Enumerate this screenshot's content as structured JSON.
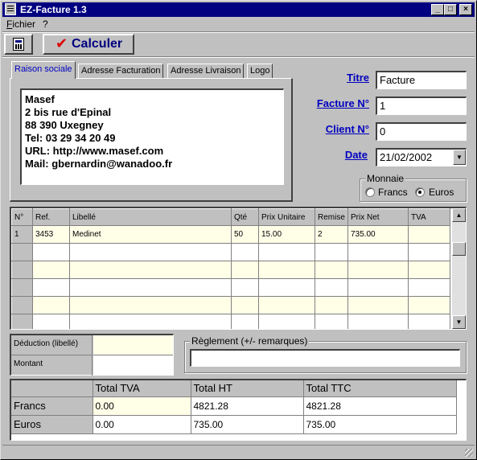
{
  "app": {
    "title": "EZ-Facture 1.3"
  },
  "menu": {
    "items": [
      "Fichier",
      "?"
    ]
  },
  "toolbar": {
    "calculate_label": "Calculer"
  },
  "tabs": [
    "Raison sociale",
    "Adresse Facturation",
    "Adresse Livraison",
    "Logo"
  ],
  "address": {
    "lines": [
      "Masef",
      "2 bis rue d'Epinal",
      "88 390 Uxegney",
      "Tel: 03 29 34 20 49",
      "URL: http://www.masef.com",
      "Mail: gbernardin@wanadoo.fr"
    ]
  },
  "fields": {
    "titre_label": "Titre",
    "titre_value": "Facture",
    "facture_label": "Facture N°",
    "facture_value": "1",
    "client_label": "Client N°",
    "client_value": "0",
    "date_label": "Date",
    "date_value": "21/02/2002"
  },
  "monnaie": {
    "title": "Monnaie",
    "francs": "Francs",
    "euros": "Euros",
    "selected": "Euros"
  },
  "grid": {
    "columns": [
      "N°",
      "Ref.",
      "Libellé",
      "Qté",
      "Prix Unitaire",
      "Remise",
      "Prix Net",
      "TVA"
    ],
    "rows": [
      [
        "1",
        "3453",
        "Medinet",
        "50",
        "15.00",
        "2",
        "735.00",
        ""
      ]
    ]
  },
  "deduction": {
    "label": "Déduction (libellé)",
    "amount_label": "Montant"
  },
  "reglement": {
    "title": "Règlement (+/- remarques)",
    "value": ""
  },
  "totals": {
    "columns": [
      "Total TVA",
      "Total HT",
      "Total TTC"
    ],
    "rows": [
      {
        "label": "Francs",
        "values": [
          "0.00",
          "4821.28",
          "4821.28"
        ]
      },
      {
        "label": "Euros",
        "values": [
          "0.00",
          "735.00",
          "735.00"
        ]
      }
    ]
  },
  "colors": {
    "title_bar": "#000080",
    "label_blue": "#0000c0",
    "check_red": "#e00000",
    "highlight_row": "#ffffe8"
  }
}
